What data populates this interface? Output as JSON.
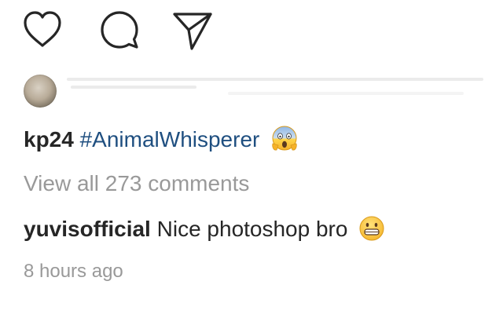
{
  "post": {
    "actions": {
      "like_icon": "heart-icon",
      "comment_icon": "comment-icon",
      "share_icon": "paper-plane-icon"
    },
    "caption": {
      "username": "kp24",
      "hashtag": "#AnimalWhisperer",
      "emoji": "face-screaming-in-fear"
    },
    "view_all_comments": "View all 273 comments",
    "comment": {
      "username": "yuvisofficial",
      "text": "Nice photoshop bro",
      "emoji": "grinning-face"
    },
    "timestamp": "8 hours ago",
    "colors": {
      "text": "#262626",
      "hashtag": "#1f4f80",
      "muted": "#999999"
    }
  }
}
